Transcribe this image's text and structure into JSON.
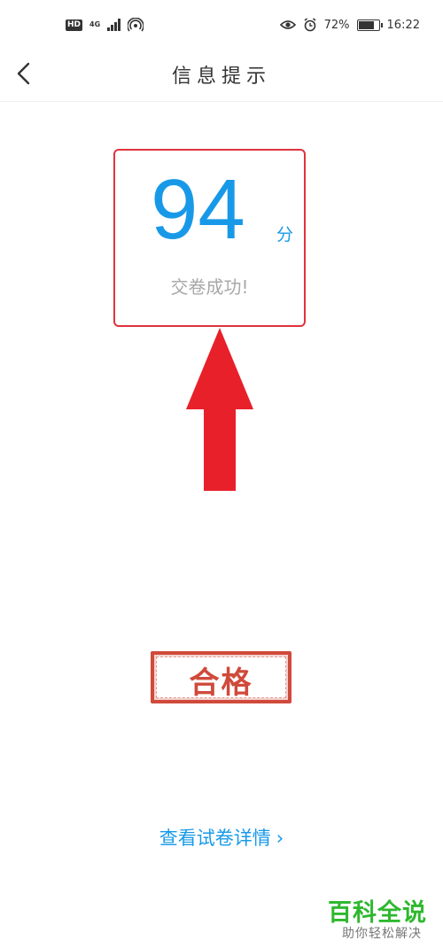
{
  "status_bar": {
    "hd": "HD",
    "network": "4G",
    "network_sub": "4G",
    "battery_pct": "72%",
    "time": "16:22",
    "icons": [
      "hd-icon",
      "signal-icon",
      "hotspot-icon",
      "eye-icon",
      "alarm-icon",
      "battery-icon"
    ]
  },
  "navbar": {
    "title": "信息提示",
    "back_icon": "chevron-left-icon"
  },
  "result": {
    "score": "94",
    "unit": "分",
    "message": "交卷成功!"
  },
  "annotation": {
    "arrow_color": "#e8202a",
    "frame_color": "#e0333d"
  },
  "stamp": {
    "text": "合格",
    "color": "#d04a3b"
  },
  "detail_link": {
    "label": "查看试卷详情",
    "chevron": "›"
  },
  "watermark": {
    "title": "百科全说",
    "subtitle": "助你轻松解决"
  },
  "colors": {
    "accent": "#1899e8",
    "muted_text": "#a8a8a8"
  }
}
